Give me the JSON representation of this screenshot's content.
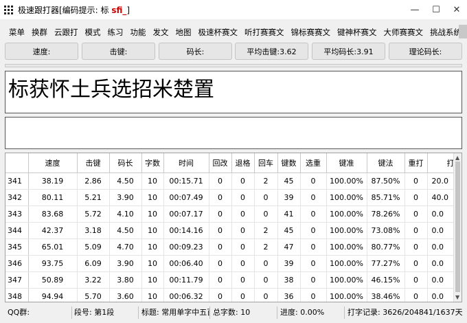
{
  "window": {
    "title_prefix": "极速跟打器[编码提示: 标 ",
    "title_accent": "sfi_",
    "title_suffix": "]",
    "minimize_glyph": "—",
    "maximize_glyph": "☐",
    "close_glyph": "✕"
  },
  "menu": [
    "菜单",
    "换群",
    "云跟打",
    "模式",
    "练习",
    "功能",
    "发文",
    "地图",
    "极速杯赛文",
    "听打赛赛文",
    "锦标赛赛文",
    "键神杯赛文",
    "大师赛赛文",
    "挑战系统"
  ],
  "stats": {
    "speed": "速度:",
    "keystroke": "击键:",
    "code_len": "码长:",
    "avg_keystroke": "平均击键:3.62",
    "avg_code_len": "平均码长:3.91",
    "theory_code_len": "理论码长:"
  },
  "text_pane": {
    "content": "标获怀土兵选招米楚置"
  },
  "table": {
    "headers": [
      "",
      "速度",
      "击键",
      "码长",
      "字数",
      "时间",
      "回改",
      "退格",
      "回车",
      "键数",
      "选重",
      "键准",
      "键法",
      "重打",
      "打"
    ],
    "rows": [
      [
        "341",
        "38.19",
        "2.86",
        "4.50",
        "10",
        "00:15.71",
        "0",
        "0",
        "2",
        "45",
        "0",
        "100.00%",
        "87.50%",
        "0",
        "20.0"
      ],
      [
        "342",
        "80.11",
        "5.21",
        "3.90",
        "10",
        "00:07.49",
        "0",
        "0",
        "0",
        "39",
        "0",
        "100.00%",
        "85.71%",
        "0",
        "40.0"
      ],
      [
        "343",
        "83.68",
        "5.72",
        "4.10",
        "10",
        "00:07.17",
        "0",
        "0",
        "0",
        "41",
        "0",
        "100.00%",
        "78.26%",
        "0",
        "0.0"
      ],
      [
        "344",
        "42.37",
        "3.18",
        "4.50",
        "10",
        "00:14.16",
        "0",
        "0",
        "2",
        "45",
        "0",
        "100.00%",
        "73.08%",
        "0",
        "0.0"
      ],
      [
        "345",
        "65.01",
        "5.09",
        "4.70",
        "10",
        "00:09.23",
        "0",
        "0",
        "2",
        "47",
        "0",
        "100.00%",
        "80.77%",
        "0",
        "0.0"
      ],
      [
        "346",
        "93.75",
        "6.09",
        "3.90",
        "10",
        "00:06.40",
        "0",
        "0",
        "0",
        "39",
        "0",
        "100.00%",
        "77.27%",
        "0",
        "0.0"
      ],
      [
        "347",
        "50.89",
        "3.22",
        "3.80",
        "10",
        "00:11.79",
        "0",
        "0",
        "0",
        "38",
        "0",
        "100.00%",
        "46.15%",
        "0",
        "0.0"
      ],
      [
        "348",
        "94.94",
        "5.70",
        "3.60",
        "10",
        "00:06.32",
        "0",
        "0",
        "0",
        "36",
        "0",
        "100.00%",
        "38.46%",
        "0",
        "0.0"
      ]
    ]
  },
  "status": {
    "qq_group": "QQ群:",
    "paragraph": "段号: 第1段",
    "title": "标题: 常用单字中五百",
    "total_chars": "总字数: 10",
    "progress": "进度: 0.00%",
    "record": "打字记录: 3626/204841/1637天"
  }
}
